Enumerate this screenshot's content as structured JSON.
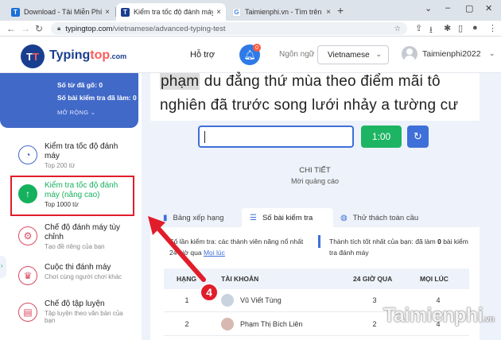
{
  "browser": {
    "tabs": [
      {
        "title": "Download - Tải Miễn Phí VN - Ph",
        "icon": "T"
      },
      {
        "title": "Kiểm tra tốc độ đánh máy, luyện",
        "icon": "T"
      },
      {
        "title": "Taimienphi.vn - Tìm trên Google",
        "icon": "G"
      }
    ],
    "new_tab": "+",
    "url_domain": "typingtop.com",
    "url_path": "/vietnamese/advanced-typing-test"
  },
  "header": {
    "logo_main": "Typing",
    "logo_accent": "top",
    "logo_domain": ".com",
    "support": "Hỗ trợ",
    "notification_count": "0",
    "language_label": "Ngôn ngữ",
    "language_value": "Vietnamese",
    "username": "Taimienphi2022"
  },
  "sidebar": {
    "stats": [
      "Số từ đã gõ: 0",
      "Số bài kiểm tra đã làm: 0"
    ],
    "expand": "MỞ RỘNG",
    "items": [
      {
        "title": "Kiểm tra tốc độ đánh máy",
        "sub": "Top 200 từ"
      },
      {
        "title": "Kiểm tra tốc độ đánh máy (nâng cao)",
        "sub": "Top 1000 từ"
      },
      {
        "title": "Chế độ đánh máy tùy chỉnh",
        "sub": "Tạo đề riêng của bạn"
      },
      {
        "title": "Cuộc thi đánh máy",
        "sub": "Chơi cùng người chơi khác"
      },
      {
        "title": "Chế độ tập luyện",
        "sub": "Tập luyện theo văn bản của bạn"
      }
    ]
  },
  "typing": {
    "line1_current": "phạm",
    "line1_rest": " du đẳng thứ mùa theo điểm mãi tô",
    "line2": "nghiên đã trước song lưới nhảy a tường cư",
    "timer": "1:00"
  },
  "detail": {
    "label": "CHI TIẾT",
    "ad": "Mời quảng cáo"
  },
  "tabs": [
    {
      "label": "Bảng xếp hạng"
    },
    {
      "label": "Số bài kiểm tra"
    },
    {
      "label": "Thử thách toàn cầu"
    }
  ],
  "panel": {
    "left_text": "Số lần kiểm tra: các thành viên năng nổ nhất 24 giờ qua",
    "left_link": "Mọi lúc",
    "right_prefix": "Thành tích tốt nhất của bạn: đã làm ",
    "right_bold": "0",
    "right_suffix": " bài kiểm tra đánh máy"
  },
  "table": {
    "headers": [
      "HẠNG",
      "TÀI KHOẢN",
      "24 GIỜ QUA",
      "MỌI LÚC"
    ],
    "rows": [
      {
        "rank": "1",
        "name": "Vũ Viết Tùng",
        "d24": "3",
        "all": "4"
      },
      {
        "rank": "2",
        "name": "Phạm Thị Bích Liên",
        "d24": "2",
        "all": "4"
      }
    ]
  },
  "annotation": {
    "step": "4",
    "watermark_pre": "Taimienphi",
    "watermark_tld": ".vn"
  },
  "colors": {
    "brand_blue": "#4169c8",
    "active_green": "#15b15d",
    "highlight_red": "#e11d2b"
  }
}
